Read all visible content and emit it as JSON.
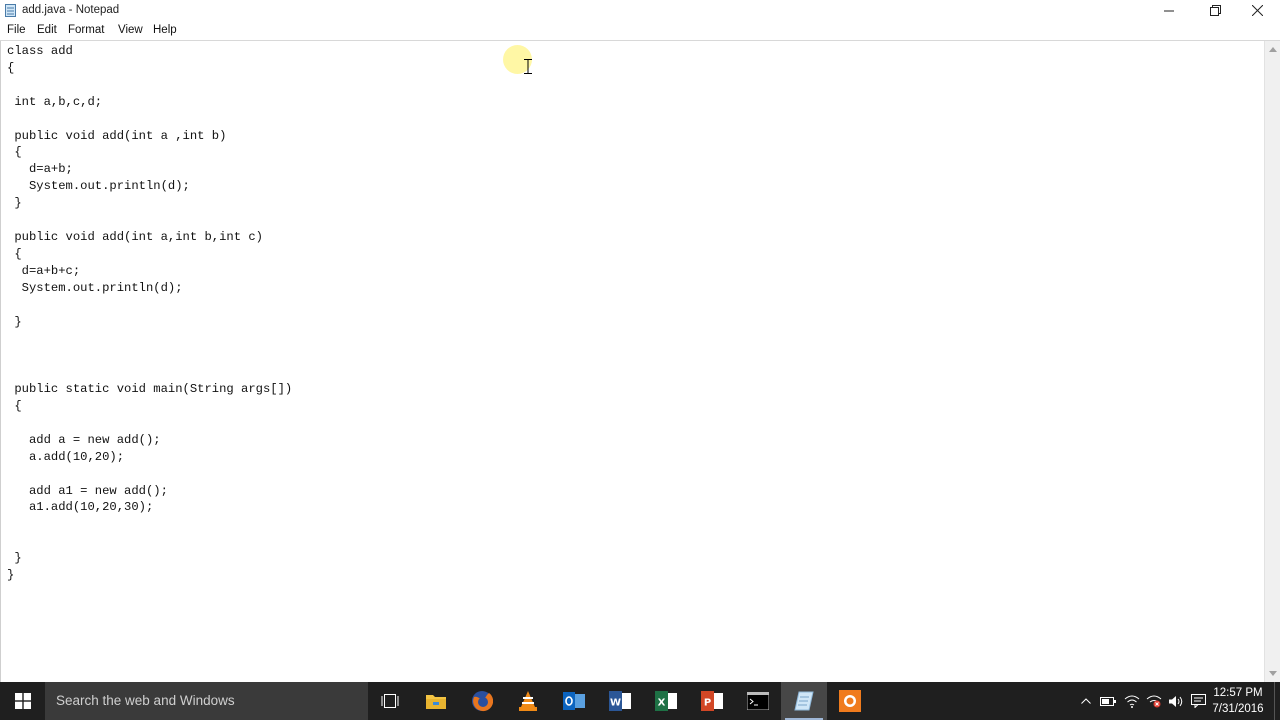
{
  "window": {
    "title": "add.java - Notepad",
    "icons": {
      "app": "notepad-icon",
      "minimize": "minimize-icon",
      "restore": "restore-icon",
      "close": "close-icon"
    }
  },
  "menu": {
    "file": "File",
    "edit": "Edit",
    "format": "Format",
    "view": "View",
    "help": "Help"
  },
  "editor": {
    "content": "class add\n{\n\n int a,b,c,d;\n\n public void add(int a ,int b)\n {\n   d=a+b;\n   System.out.println(d);\n }\n\n public void add(int a,int b,int c)\n {\n  d=a+b+c;\n  System.out.println(d);\n\n }\n\n\n\n public static void main(String args[])\n {\n\n   add a = new add();\n   a.add(10,20);\n\n   add a1 = new add();\n   a1.add(10,20,30);\n\n\n }\n}"
  },
  "taskbar": {
    "search_placeholder": "Search the web and Windows",
    "apps": [
      "task-view-icon",
      "file-explorer-icon",
      "firefox-icon",
      "vlc-icon",
      "outlook-icon",
      "word-icon",
      "excel-icon",
      "powerpoint-icon",
      "command-prompt-icon",
      "notepad-icon",
      "recorder-icon"
    ],
    "clock": {
      "time": "12:57 PM",
      "date": "7/31/2016"
    }
  },
  "colors": {
    "taskbar_bg": "#1f1f1f",
    "search_bg": "#3a3a3a",
    "cursor_highlight": "#fff7a0"
  }
}
